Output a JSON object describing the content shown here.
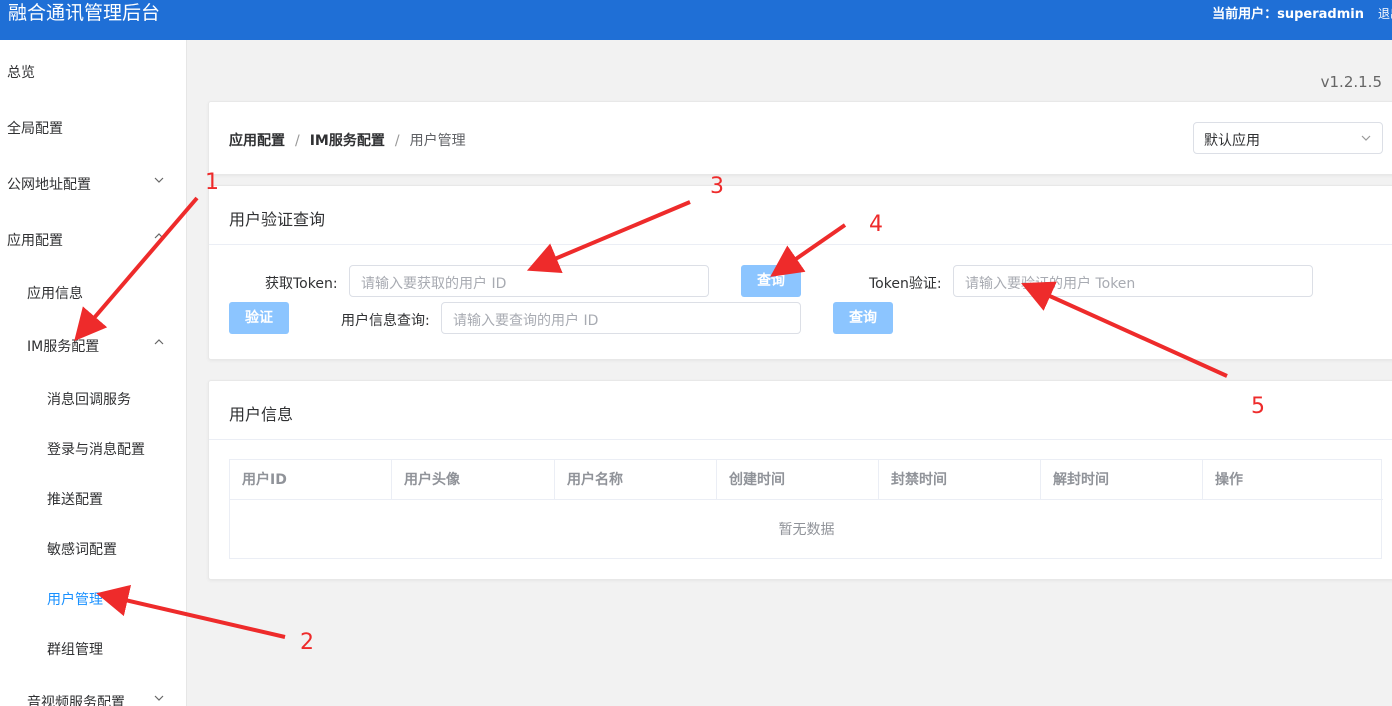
{
  "header": {
    "app_title": "融合通讯管理后台",
    "user_label": "当前用户：superadmin",
    "logout_label": "退出"
  },
  "sidebar": {
    "items": [
      {
        "label": "总览"
      },
      {
        "label": "全局配置"
      },
      {
        "label": "公网地址配置"
      },
      {
        "label": "应用配置"
      },
      {
        "label": "应用信息"
      },
      {
        "label": "IM服务配置"
      },
      {
        "label": "消息回调服务"
      },
      {
        "label": "登录与消息配置"
      },
      {
        "label": "推送配置"
      },
      {
        "label": "敏感词配置"
      },
      {
        "label": "用户管理"
      },
      {
        "label": "群组管理"
      },
      {
        "label": "音视频服务配置"
      }
    ]
  },
  "version": "v1.2.1.5",
  "breadcrumb": {
    "items": [
      "应用配置",
      "IM服务配置",
      "用户管理"
    ],
    "separator": "/"
  },
  "app_select": {
    "value": "默认应用"
  },
  "verify_card": {
    "title": "用户验证查询",
    "get_token_label": "获取Token:",
    "get_token_placeholder": "请输入要获取的用户 ID",
    "query_button": "查询",
    "token_verify_label": "Token验证:",
    "token_verify_placeholder": "请输入要验证的用户 Token",
    "verify_button": "验证",
    "user_info_label": "用户信息查询:",
    "user_info_placeholder": "请输入要查询的用户 ID",
    "query_button_2": "查询"
  },
  "user_info_card": {
    "title": "用户信息",
    "columns": [
      "用户ID",
      "用户头像",
      "用户名称",
      "创建时间",
      "封禁时间",
      "解封时间",
      "操作"
    ],
    "empty_text": "暂无数据"
  },
  "annotations": [
    "1",
    "2",
    "3",
    "4",
    "5"
  ],
  "colors": {
    "header_bg": "#1f6fd6",
    "active_menu": "#1890ff",
    "button_bg": "#8cc5ff",
    "annotation": "#ee2b2b"
  }
}
